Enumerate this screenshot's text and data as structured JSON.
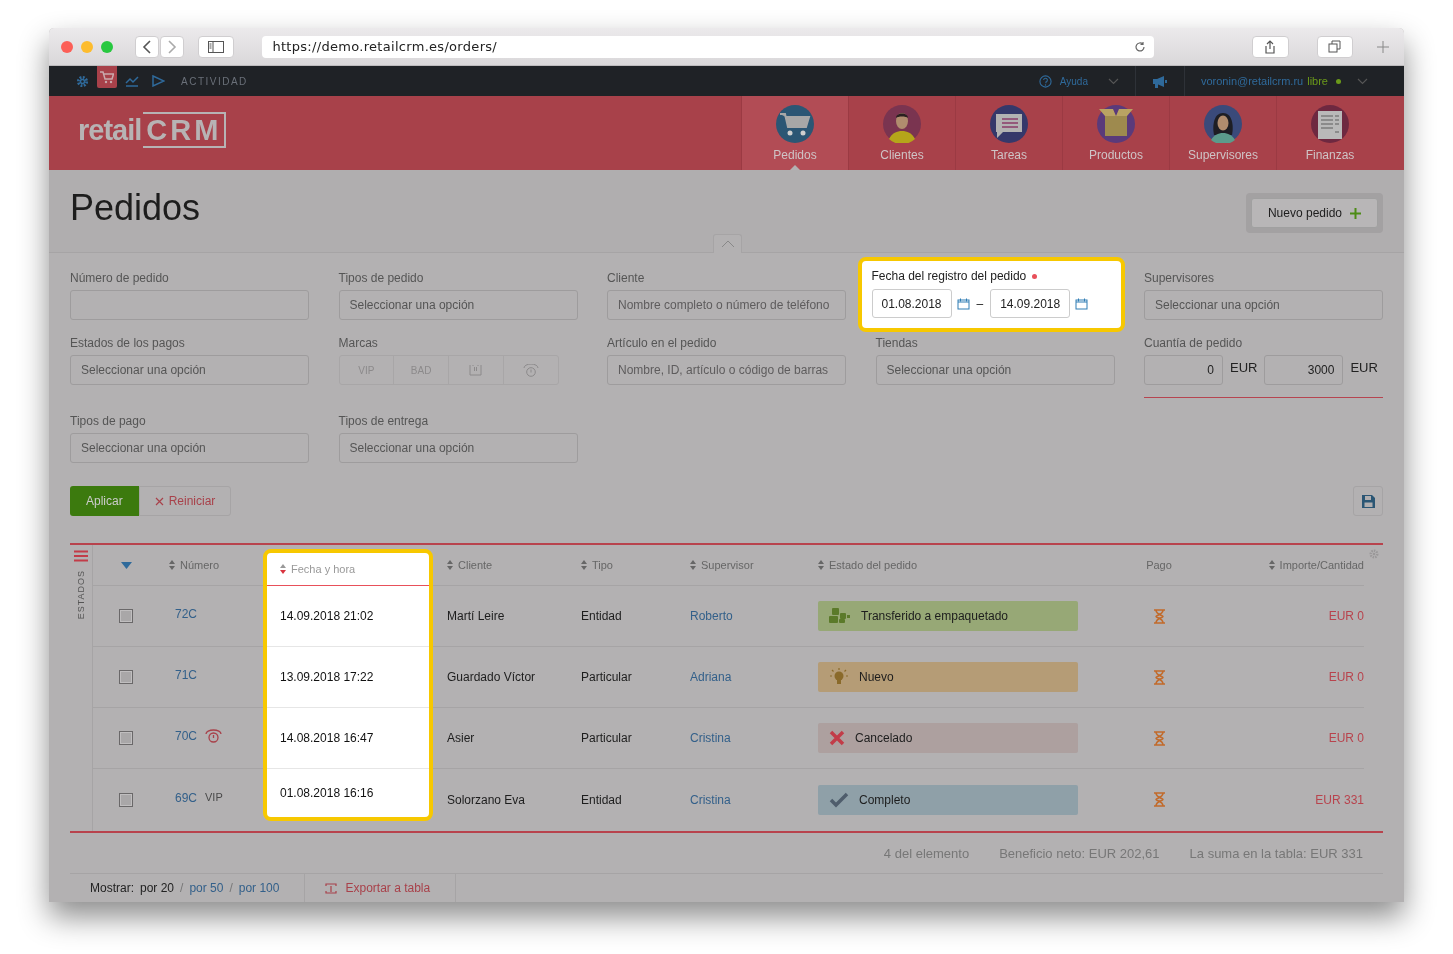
{
  "browser": {
    "url": "https://demo.retailcrm.es/orders/"
  },
  "topbar": {
    "shortcuts": [
      {
        "kind": "settings",
        "selected": false
      },
      {
        "kind": "cart",
        "selected": true
      },
      {
        "kind": "chart",
        "selected": false
      },
      {
        "kind": "play",
        "selected": false
      }
    ],
    "activity": "ACTIVIDAD",
    "help": "Ayuda",
    "user": "voronin@retailcrm.ru",
    "user_status": "libre"
  },
  "header": {
    "logo": [
      "retail",
      "CRM"
    ],
    "nav": [
      {
        "label": "Pedidos",
        "kind": "cart",
        "selected": true
      },
      {
        "label": "Clientes",
        "kind": "man",
        "selected": false
      },
      {
        "label": "Tareas",
        "kind": "chat",
        "selected": false
      },
      {
        "label": "Productos",
        "kind": "box",
        "selected": false
      },
      {
        "label": "Supervisores",
        "kind": "woman",
        "selected": false
      },
      {
        "label": "Finanzas",
        "kind": "sheet",
        "selected": false
      }
    ]
  },
  "page": {
    "title": "Pedidos",
    "new_button": "Nuevo pedido"
  },
  "filters": [
    {
      "label": "Número de pedido",
      "kind": "input"
    },
    {
      "label": "Tipos de pedido",
      "kind": "select",
      "placeholder": "Seleccionar una opción"
    },
    {
      "label": "Cliente",
      "kind": "input",
      "placeholder": "Nombre completo o número de teléfono"
    },
    {
      "label": "Fecha del registro del pedido",
      "kind": "date_range",
      "required": true,
      "highlighted": true,
      "from": "01.08.2018",
      "to": "14.09.2018",
      "separator": "–"
    },
    {
      "label": "Supervisores",
      "kind": "select",
      "placeholder": "Seleccionar una opción"
    },
    {
      "label": "Estados de los pagos",
      "kind": "select",
      "placeholder": "Seleccionar una opción"
    },
    {
      "label": "Marcas",
      "kind": "tags",
      "tags": [
        {
          "kind": "text",
          "label": "VIP",
          "selected": false
        },
        {
          "kind": "text",
          "label": "BAD",
          "selected": false
        },
        {
          "kind": "flag",
          "selected": false
        },
        {
          "kind": "alarm",
          "selected": false
        }
      ]
    },
    {
      "label": "Artículo en el pedido",
      "kind": "input",
      "placeholder": "Nombre, ID, artículo o código de barras"
    },
    {
      "label": "Tiendas",
      "kind": "select",
      "placeholder": "Seleccionar una opción"
    },
    {
      "label": "Cuantía de pedido",
      "kind": "amount",
      "from": "0",
      "from_currency": "EUR",
      "to": "3000",
      "to_currency": "EUR"
    },
    {
      "label": "Tipos de pago",
      "kind": "select",
      "placeholder": "Seleccionar una opción"
    },
    {
      "label": "Tipos de entrega",
      "kind": "select",
      "placeholder": "Seleccionar una opción"
    }
  ],
  "actions": {
    "apply": "Aplicar",
    "reset": "Reiniciar"
  },
  "table": {
    "side_label": "ESTADOS",
    "columns": [
      {
        "label": "Número",
        "sortable": true
      },
      {
        "label": "Fecha y hora",
        "sortable": true,
        "highlighted": true
      },
      {
        "label": "Cliente",
        "sortable": true
      },
      {
        "label": "Tipo",
        "sortable": true
      },
      {
        "label": "Supervisor",
        "sortable": true
      },
      {
        "label": "Estado del pedido",
        "sortable": true
      },
      {
        "label": "Pago",
        "sortable": false
      },
      {
        "label": "Importe/Cantidad",
        "sortable": true
      }
    ],
    "rows": [
      {
        "checked": false,
        "number": "72C",
        "date": "14.09.2018 21:02",
        "client": "Martí Leire",
        "type": "Entidad",
        "supervisor": "Roberto",
        "status": {
          "label": "Transferido a empaquetado",
          "kind": "packed",
          "color": "#97a876"
        },
        "amount": "EUR 0"
      },
      {
        "checked": false,
        "number": "71C",
        "date": "13.09.2018 17:22",
        "client": "Guardado Víctor",
        "type": "Particular",
        "supervisor": "Adriana",
        "status": {
          "label": "Nuevo",
          "kind": "new",
          "color": "#b59c76"
        },
        "amount": "EUR 0"
      },
      {
        "checked": false,
        "number": "70C",
        "mark": {
          "kind": "alarm"
        },
        "date": "14.08.2018 16:47",
        "client": "Asier",
        "type": "Particular",
        "supervisor": "Cristina",
        "status": {
          "label": "Cancelado",
          "kind": "cancelled",
          "color": "#ada09f"
        },
        "amount": "EUR 0"
      },
      {
        "checked": false,
        "number": "69C",
        "mark": {
          "kind": "text",
          "label": "VIP"
        },
        "date": "01.08.2018 16:16",
        "client": "Solorzano Eva",
        "type": "Entidad",
        "supervisor": "Cristina",
        "status": {
          "label": "Completo",
          "kind": "complete",
          "color": "#8fa0a8"
        },
        "amount": "EUR 331"
      }
    ]
  },
  "summary": [
    "4 del elemento",
    "Beneficio neto: EUR 202,61",
    "La suma en la tabla: EUR 331"
  ],
  "pager": {
    "label": "Mostrar:",
    "options": [
      "por 20",
      "por 50",
      "por 100"
    ],
    "separator": "/",
    "export": "Exportar a tabla"
  }
}
